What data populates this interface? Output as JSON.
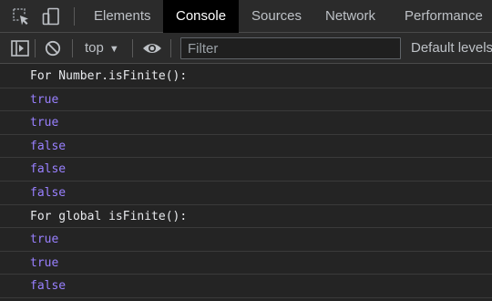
{
  "devtools": {
    "tabs": [
      {
        "label": "Elements",
        "active": false
      },
      {
        "label": "Console",
        "active": true
      },
      {
        "label": "Sources",
        "active": false
      },
      {
        "label": "Network",
        "active": false
      },
      {
        "label": "Performance",
        "active": false
      }
    ],
    "icons": [
      "inspect-element-icon",
      "device-toolbar-icon"
    ]
  },
  "toolbar": {
    "icons": [
      "sidebar-toggle-icon",
      "clear-console-icon",
      "live-expression-icon"
    ],
    "context": "top",
    "filter_placeholder": "Filter",
    "filter_value": "",
    "levels_label": "Default levels"
  },
  "console": {
    "messages": [
      {
        "text": "For Number.isFinite():",
        "type": "log"
      },
      {
        "text": "true",
        "type": "boolean"
      },
      {
        "text": "true",
        "type": "boolean"
      },
      {
        "text": "false",
        "type": "boolean"
      },
      {
        "text": "false",
        "type": "boolean"
      },
      {
        "text": "false",
        "type": "boolean"
      },
      {
        "text": "For global isFinite():",
        "type": "log"
      },
      {
        "text": "true",
        "type": "boolean"
      },
      {
        "text": "true",
        "type": "boolean"
      },
      {
        "text": "false",
        "type": "boolean"
      }
    ]
  },
  "colors": {
    "background": "#242424",
    "toolbar": "#2b2b2b",
    "active_tab": "#000000",
    "boolean_value": "#9980ff",
    "log_text": "#e8eaed"
  }
}
